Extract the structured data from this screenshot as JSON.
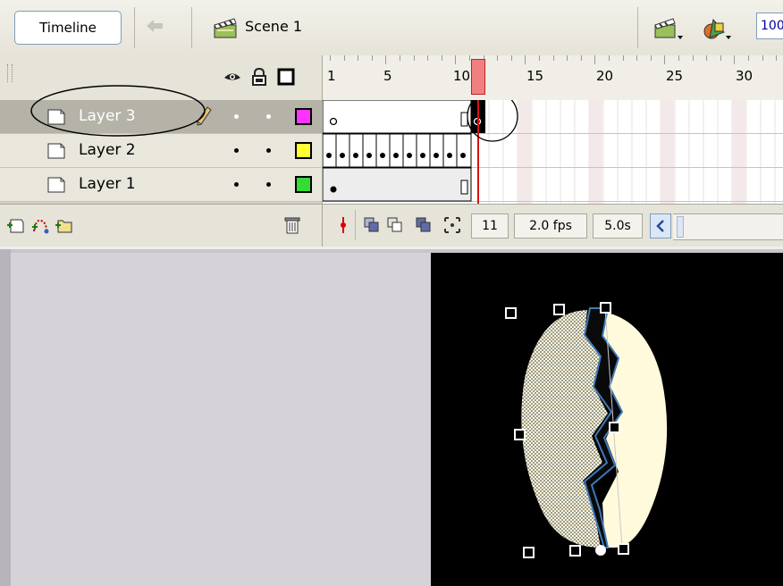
{
  "toolbar": {
    "timeline_button": "Timeline",
    "scene_label": "Scene 1",
    "zoom_value": "100"
  },
  "ruler": {
    "labels": [
      "1",
      "5",
      "10",
      "15",
      "20",
      "25",
      "30"
    ]
  },
  "layers": [
    {
      "name": "Layer 3",
      "color": "#ff33ff",
      "selected": true
    },
    {
      "name": "Layer 2",
      "color": "#ffff33",
      "selected": false
    },
    {
      "name": "Layer 1",
      "color": "#33dd33",
      "selected": false
    }
  ],
  "status": {
    "current_frame": "11",
    "frame_rate": "2.0 fps",
    "elapsed_time": "5.0s"
  },
  "colors": {
    "playhead": "#dd1111",
    "stage": "#000000",
    "shape_fill": "#fffadc"
  }
}
